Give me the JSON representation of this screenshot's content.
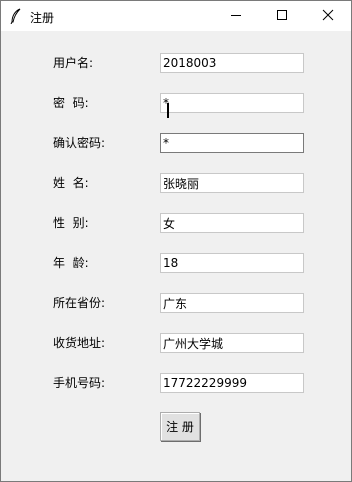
{
  "window": {
    "title": "注册"
  },
  "form": {
    "fields": [
      {
        "label": "用户名:",
        "value": "2018003"
      },
      {
        "label": "密  码:",
        "value": "*"
      },
      {
        "label": "确认密码:",
        "value": "*"
      },
      {
        "label": "姓  名:",
        "value": "张晓丽"
      },
      {
        "label": "性  别:",
        "value": "女"
      },
      {
        "label": "年  龄:",
        "value": "18"
      },
      {
        "label": "所在省份:",
        "value": "广东"
      },
      {
        "label": "收货地址:",
        "value": "广州大学城"
      },
      {
        "label": "手机号码:",
        "value": "17722229999"
      }
    ],
    "submit_label": "注 册"
  }
}
